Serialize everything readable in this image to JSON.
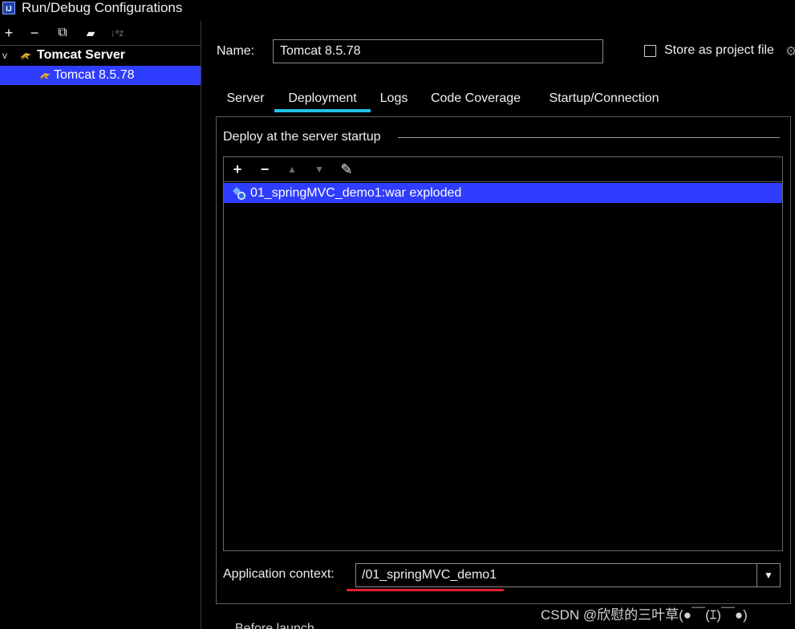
{
  "window": {
    "title": "Run/Debug Configurations",
    "app_icon_text": "IJ"
  },
  "left_toolbar": {
    "icons": [
      "plus-icon",
      "minus-icon",
      "copy-icon",
      "folder-add-icon",
      "sort-icon"
    ],
    "plus": "+",
    "minus": "−",
    "copy": "⧉",
    "folder": "▰",
    "sort": "↓ᵃz"
  },
  "tree": {
    "category_label": "Tomcat Server",
    "item_label": "Tomcat 8.5.78",
    "expand_glyph": "v"
  },
  "form": {
    "name_label": "Name:",
    "name_value": "Tomcat 8.5.78",
    "store_label": "Store as project file",
    "gear": "⚙"
  },
  "tabs": [
    {
      "label": "Server"
    },
    {
      "label": "Deployment",
      "active": true
    },
    {
      "label": "Logs"
    },
    {
      "label": "Code Coverage"
    },
    {
      "label": "Startup/Connection"
    }
  ],
  "deployment": {
    "group_title": "Deploy at the server startup",
    "toolbar": {
      "add": "+",
      "remove": "−",
      "up": "▲",
      "down": "▼",
      "edit": "✎"
    },
    "artifacts": [
      "01_springMVC_demo1:war exploded"
    ],
    "app_context_label": "Application context:",
    "app_context_value": "/01_springMVC_demo1",
    "combo_arrow": "▼"
  },
  "footer": {
    "partial_text": "Before launch",
    "watermark": "CSDN @欣慰的三叶草(●￣(ｴ)￣●)"
  },
  "colors": {
    "selection": "#2f3dff",
    "tab_underline": "#22c2e8",
    "annotation_underline": "#e3202a",
    "background": "#000000"
  }
}
